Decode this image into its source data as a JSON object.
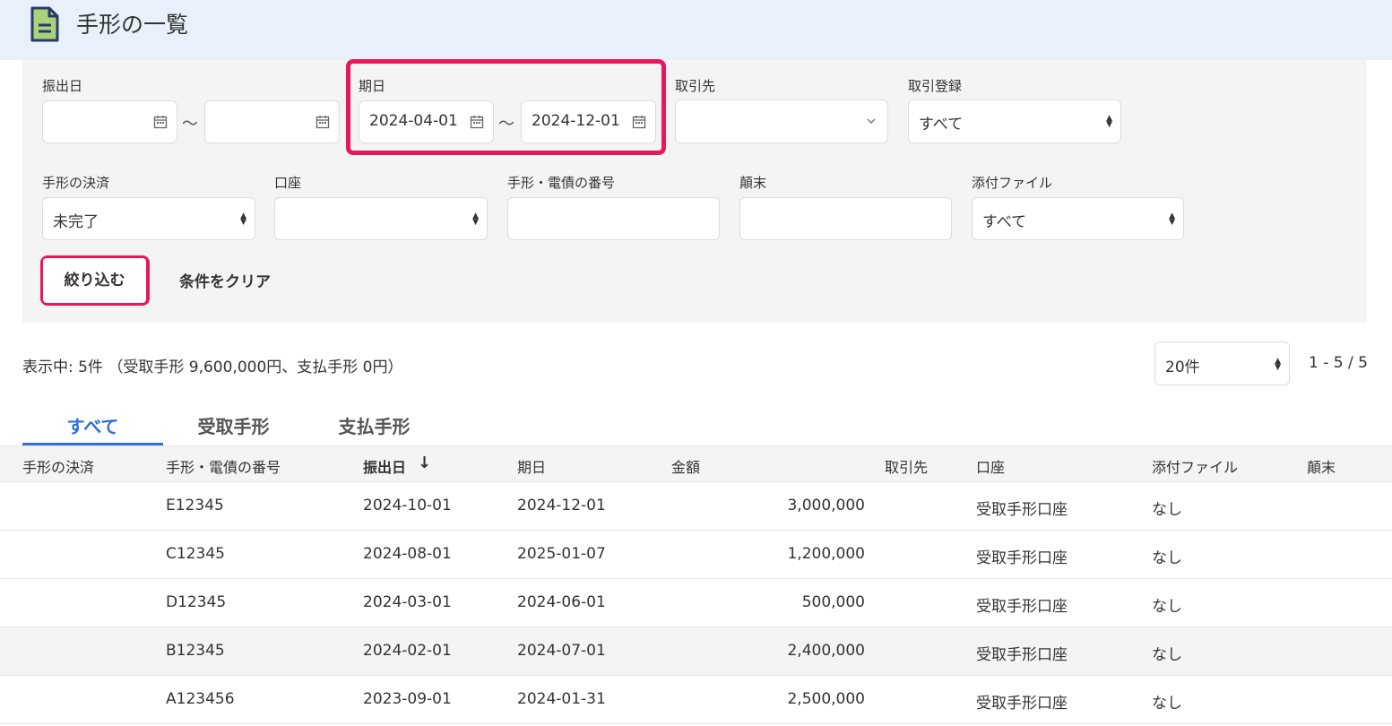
{
  "header": {
    "title": "手形の一覧",
    "icon": "document-icon"
  },
  "filters": {
    "issue_date": {
      "label": "振出日",
      "from": "",
      "to": "",
      "separator": "～"
    },
    "due_date": {
      "label": "期日",
      "from": "2024-04-01",
      "to": "2024-12-01",
      "separator": "～"
    },
    "partner": {
      "label": "取引先",
      "value": ""
    },
    "registration": {
      "label": "取引登録",
      "value": "すべて"
    },
    "settlement": {
      "label": "手形の決済",
      "value": "未完了"
    },
    "account": {
      "label": "口座",
      "value": ""
    },
    "number": {
      "label": "手形・電債の番号",
      "value": ""
    },
    "endorsement": {
      "label": "顛末",
      "value": ""
    },
    "attachment": {
      "label": "添付ファイル",
      "value": "すべて"
    },
    "apply_label": "絞り込む",
    "clear_label": "条件をクリア"
  },
  "summary": "表示中: 5件 （受取手形 9,600,000円、支払手形 0円）",
  "per_page": "20件",
  "pagination": "1 - 5 / 5",
  "tabs": [
    {
      "label": "すべて",
      "active": true
    },
    {
      "label": "受取手形",
      "active": false
    },
    {
      "label": "支払手形",
      "active": false
    }
  ],
  "table": {
    "headers": {
      "settlement": "手形の決済",
      "number": "手形・電債の番号",
      "issue_date": "振出日",
      "due_date": "期日",
      "amount": "金額",
      "partner": "取引先",
      "account": "口座",
      "attachment": "添付ファイル",
      "endorsement": "顛末"
    },
    "sort_indicator": "↓",
    "rows": [
      {
        "settlement": "",
        "number": "E12345",
        "issue_date": "2024-10-01",
        "due_date": "2024-12-01",
        "amount": "3,000,000",
        "partner": "",
        "account": "受取手形口座",
        "attachment": "なし",
        "endorsement": ""
      },
      {
        "settlement": "",
        "number": "C12345",
        "issue_date": "2024-08-01",
        "due_date": "2025-01-07",
        "amount": "1,200,000",
        "partner": "",
        "account": "受取手形口座",
        "attachment": "なし",
        "endorsement": ""
      },
      {
        "settlement": "",
        "number": "D12345",
        "issue_date": "2024-03-01",
        "due_date": "2024-06-01",
        "amount": "500,000",
        "partner": "",
        "account": "受取手形口座",
        "attachment": "なし",
        "endorsement": ""
      },
      {
        "settlement": "",
        "number": "B12345",
        "issue_date": "2024-02-01",
        "due_date": "2024-07-01",
        "amount": "2,400,000",
        "partner": "",
        "account": "受取手形口座",
        "attachment": "なし",
        "endorsement": ""
      },
      {
        "settlement": "",
        "number": "A123456",
        "issue_date": "2023-09-01",
        "due_date": "2024-01-31",
        "amount": "2,500,000",
        "partner": "",
        "account": "受取手形口座",
        "attachment": "なし",
        "endorsement": ""
      }
    ]
  },
  "colors": {
    "highlight": "#e8175d",
    "accent": "#2f6fd6",
    "header_bg": "#e8f0fc",
    "panel_bg": "#f5f4f4",
    "icon_green": "#a8d37a",
    "icon_navy": "#2b3a67"
  }
}
